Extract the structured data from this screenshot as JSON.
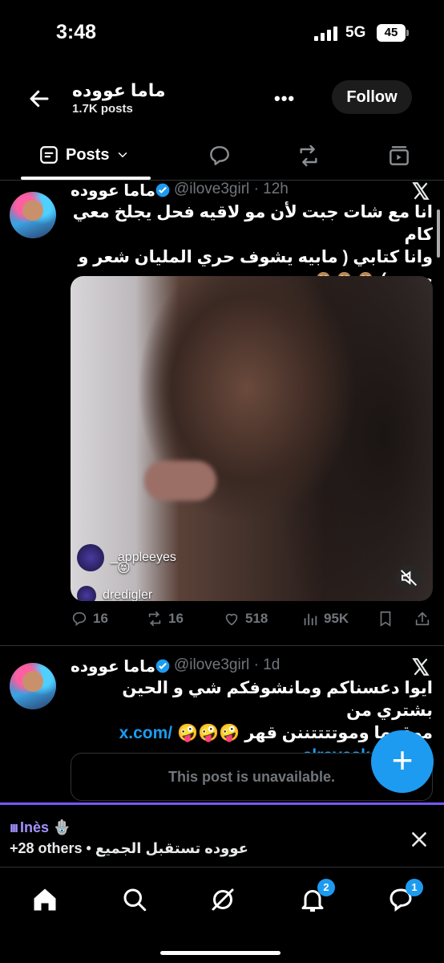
{
  "status_bar": {
    "time": "3:48",
    "network": "5G",
    "battery": "45"
  },
  "header": {
    "title": "ماما عووده",
    "subtitle": "1.7K posts",
    "more": "•••",
    "follow_label": "Follow"
  },
  "tabs": {
    "posts_label": "Posts"
  },
  "posts": [
    {
      "display_name": "ماما عووده",
      "handle": "@ilove3girl",
      "time": "· 12h",
      "text_lines": [
        "انا مع شات جبت لأن مو لاقيه فحل يجلخ معي كام",
        "وانا كتابي ( مابيه يشوف حري المليان شعر و",
        "حبوب) 🙊🙊🙊"
      ],
      "media": {
        "comments": [
          {
            "user": "_appleeyes",
            "emoji": "😝"
          },
          {
            "user": "dredigler"
          }
        ]
      },
      "actions": {
        "replies": "16",
        "reposts": "16",
        "likes": "518",
        "views": "95K"
      }
    },
    {
      "display_name": "ماما عووده",
      "handle": "@ilove3girl",
      "time": "· 1d",
      "text_lines": [
        "ايوا دعسناكم ومانشوفكم شي و الحين بشتري من",
        "موقعها وموتتتتننن قهر 🤪🤪🤪"
      ],
      "link_1": "x.com/",
      "link_2": "alrayeskofaya/...",
      "unavailable": "This post is unavailable."
    }
  ],
  "fab": "+",
  "spaces": {
    "title": "Inès 🪬",
    "subtitle": "+28 others • عووده تستقبل الجميع"
  },
  "nav": {
    "notifications_badge": "2",
    "messages_badge": "1"
  },
  "colors": {
    "accent": "#1d9bf0",
    "spaces": "#7856ff",
    "muted": "#71767b"
  }
}
